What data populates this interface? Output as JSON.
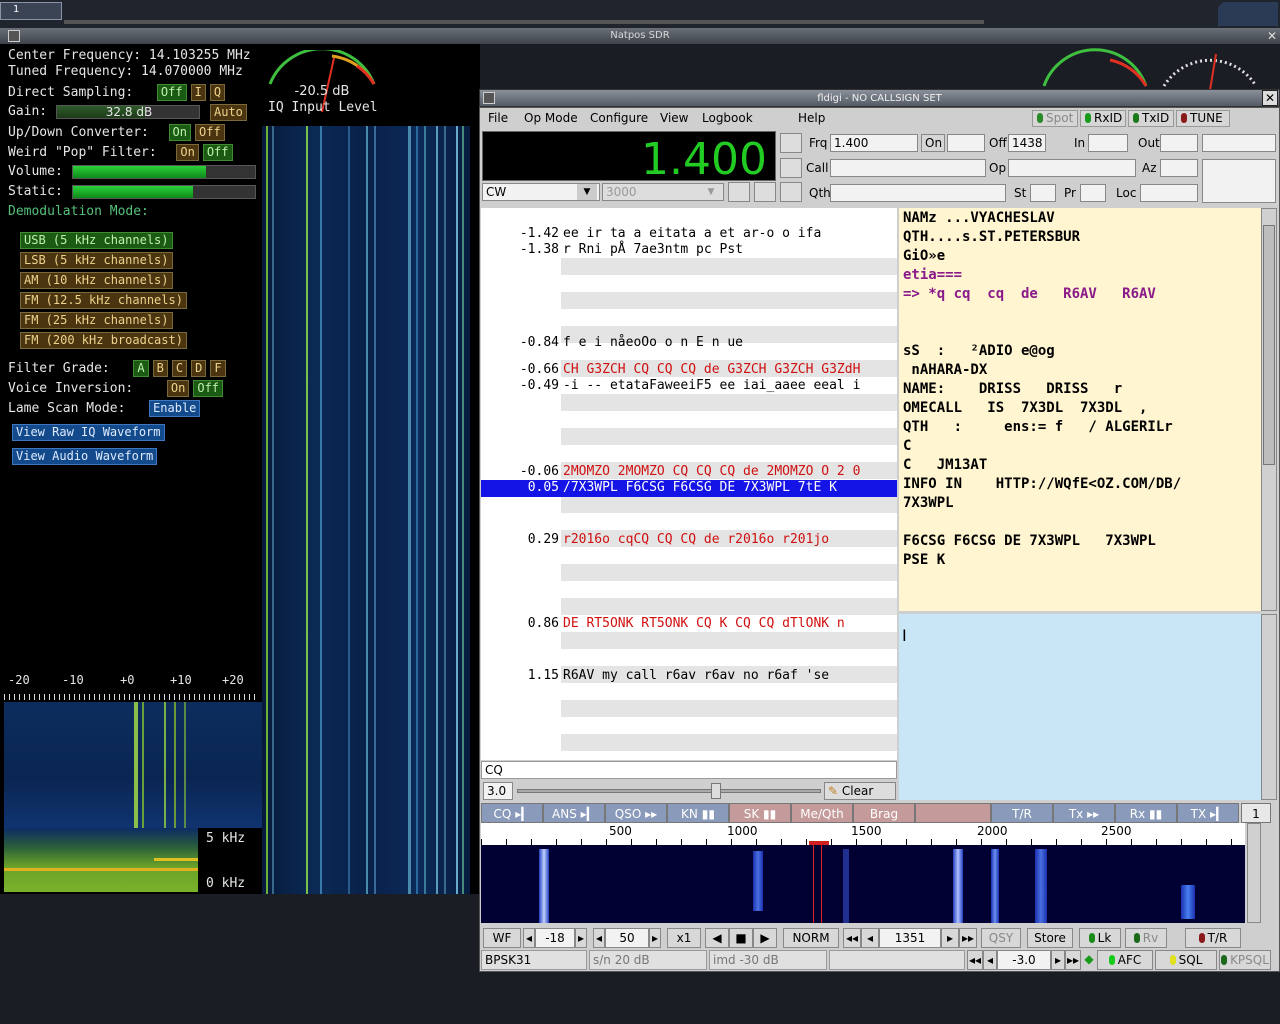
{
  "desktop": {
    "workspace": "1"
  },
  "natpos": {
    "title": "Natpos SDR",
    "center_freq": "Center Frequency: 14.103255 MHz",
    "tuned_freq": "Tuned Frequency: 14.070000 MHz",
    "direct_sampling_label": "Direct Sampling:",
    "direct_sampling": [
      "Off",
      "I",
      "Q"
    ],
    "gain_label": "Gain:",
    "gain_value": "32.8 dB",
    "gain_level": 0.62,
    "gain_auto": "Auto",
    "updown_label": "Up/Down Converter:",
    "updown": [
      "On",
      "Off"
    ],
    "pop_label": "Weird \"Pop\" Filter:",
    "pop": [
      "On",
      "Off"
    ],
    "volume_label": "Volume:",
    "volume_level": 0.73,
    "static_label": "Static:",
    "static_level": 0.66,
    "demod_label": "Demodulation Mode:",
    "demod_modes": [
      "USB (5 kHz channels)",
      "LSB (5 kHz channels)",
      "AM (10 kHz channels)",
      "FM (12.5 kHz channels)",
      "FM (25 kHz channels)",
      "FM (200 kHz broadcast)"
    ],
    "filter_label": "Filter Grade:",
    "filter_grades": [
      "A",
      "B",
      "C",
      "D",
      "F"
    ],
    "voice_label": "Voice Inversion:",
    "voice": [
      "On",
      "Off"
    ],
    "lame_label": "Lame Scan Mode:",
    "lame_btn": "Enable",
    "view_iq": "View Raw IQ Waveform",
    "view_audio": "View Audio Waveform",
    "iq_level_value": "-20.5 dB",
    "iq_level_label": "IQ Input Level",
    "scale_ticks": [
      "-20",
      "-10",
      "+0",
      "+10",
      "+20"
    ],
    "audio_scale": [
      "5 kHz",
      "0 kHz"
    ]
  },
  "fldigi": {
    "title": "fldigi - NO CALLSIGN SET",
    "menu": [
      "File",
      "Op Mode",
      "Configure",
      "View",
      "Logbook",
      "Help"
    ],
    "flags": [
      "Spot",
      "RxID",
      "TxID",
      "TUNE"
    ],
    "freq_display": "1.400",
    "frq_label": "Frq",
    "frq_value": "1.400",
    "on_btn": "On",
    "off_label": "Off",
    "off_value": "1438",
    "in_label": "In",
    "out_label": "Out",
    "call_label": "Call",
    "op_label": "Op",
    "az_label": "Az",
    "qth_label": "Qth",
    "st_label": "St",
    "pr_label": "Pr",
    "loc_label": "Loc",
    "mode_select": "CW",
    "bw_select": "3000",
    "rx_rows": [
      {
        "val": "-1.42",
        "text": "ee ir ta a eitata a   et ar-o o  ifa",
        "color": "black"
      },
      {
        "val": "-1.38",
        "text": "r Rni  pÅ  7ae3ntm   pc Pst",
        "color": "black"
      },
      {
        "val": "-0.84",
        "text": "f   e i   nåeoOo o   n    E n    ue",
        "color": "black"
      },
      {
        "val": "-0.66",
        "text": "CH G3ZCH  CQ CQ CQ de G3ZCH G3ZCH G3ZdH",
        "color": "red"
      },
      {
        "val": "-0.49",
        "text": "-i -- etataFaweeiF5  ee iai_aaee eeal i",
        "color": "black"
      },
      {
        "val": "-0.06",
        "text": " 2MOMZO 2MOMZO CQ CQ CQ de 2MOMZO O 2 0",
        "color": "red"
      },
      {
        "val": "0.05",
        "text": "/7X3WPL  F6CSG F6CSG DE 7X3WPL   7tE K",
        "color": "sel"
      },
      {
        "val": "0.29",
        "text": " r2016o cqCQ  CQ CQ  de  r2016o r201jo",
        "color": "red"
      },
      {
        "val": "0.86",
        "text": "DE RT5ONK  RT5ONK CQ K  CQ CQ  dTlONK n",
        "color": "red"
      },
      {
        "val": "1.15",
        "text": " R6AV   my call r6av r6av  no r6af 'se",
        "color": "black"
      }
    ],
    "rx_text": [
      {
        "t": "NAMz ...VYACHESLAV",
        "c": ""
      },
      {
        "t": "QTH....s.ST.PETERSBUR",
        "c": ""
      },
      {
        "t": "GiO»e",
        "c": ""
      },
      {
        "t": "etia===",
        "c": "purple"
      },
      {
        "t": "=> *q cq  cq  de   R6AV   R6AV",
        "c": "purple"
      },
      {
        "t": "",
        "c": ""
      },
      {
        "t": "",
        "c": ""
      },
      {
        "t": "sS  :   ²ADIO e@og",
        "c": ""
      },
      {
        "t": " nAHARA-DX",
        "c": ""
      },
      {
        "t": "NAME:    DRISS   DRISS   r",
        "c": ""
      },
      {
        "t": "OMECALL   IS  7X3DL  7X3DL  ,",
        "c": ""
      },
      {
        "t": "QTH   :     ens:= f   / ALGERILr",
        "c": ""
      },
      {
        "t": "C",
        "c": ""
      },
      {
        "t": "C   JM13AT",
        "c": ""
      },
      {
        "t": "INFO IN    HTTP://WQfE<OZ.COM/DB/",
        "c": ""
      },
      {
        "t": "7X3WPL",
        "c": ""
      },
      {
        "t": "",
        "c": ""
      },
      {
        "t": "F6CSG F6CSG DE 7X3WPL   7X3WPL",
        "c": ""
      },
      {
        "t": "PSE K",
        "c": ""
      }
    ],
    "cq_field": "CQ",
    "slider_value": "3.0",
    "clear_btn": "Clear",
    "macros": [
      "CQ",
      "ANS",
      "QSO",
      "KN",
      "SK",
      "Me/Qth",
      "Brag",
      "",
      "T/R",
      "Tx",
      "Rx",
      "TX",
      "1"
    ],
    "wf_ticks": [
      "500",
      "1000",
      "1500",
      "2000",
      "2500"
    ],
    "wf_ctrl": {
      "wf": "WF",
      "lvl": "-18",
      "rng": "50",
      "x1": "x1",
      "norm": "NORM",
      "freq": "1351",
      "qsy": "QSY",
      "store": "Store",
      "lk": "Lk",
      "rv": "Rv",
      "tr": "T/R"
    },
    "status": {
      "mode": "BPSK31",
      "sn": "s/n 20 dB",
      "imd": "imd -30 dB",
      "val": "-3.0",
      "afc": "AFC",
      "sql": "SQL",
      "kpsql": "KPSQL"
    }
  }
}
